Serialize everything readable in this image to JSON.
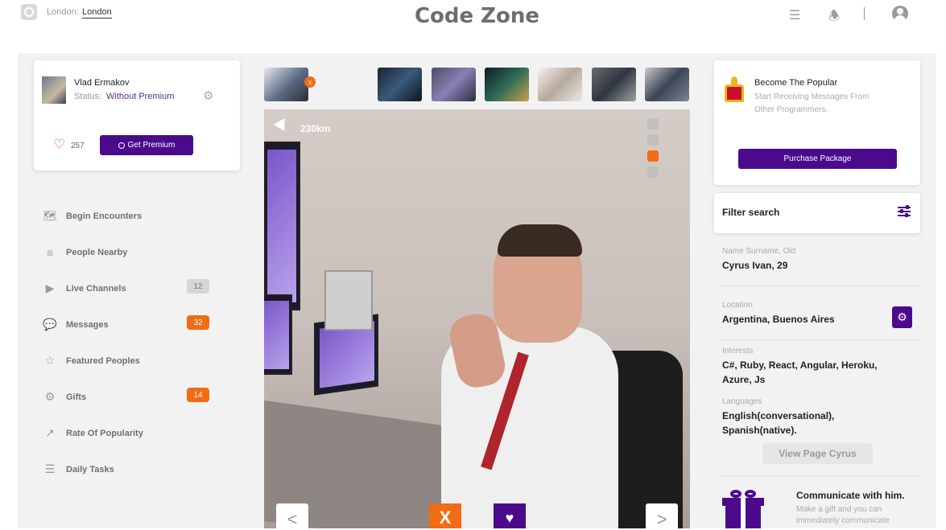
{
  "topbar": {
    "location_label": "London:",
    "location_value": "London",
    "brand": "Code Zone",
    "icons": [
      "list-icon",
      "bell-icon",
      "user-icon"
    ]
  },
  "profile": {
    "name": "Vlad Ermakov",
    "status_label": "Status:",
    "status_value": "Without Premium",
    "likes": "257",
    "premium_button": "Get Premium"
  },
  "menu": {
    "items": [
      {
        "label": "Begin Encounters",
        "icon": "map-icon"
      },
      {
        "label": "People Nearby",
        "icon": "stack-icon"
      },
      {
        "label": "Live Channels",
        "icon": "video-icon",
        "badge": "12"
      },
      {
        "label": "Messages",
        "icon": "chat-icon",
        "badge": "32"
      },
      {
        "label": "Featured Peoples",
        "icon": "star-icon"
      },
      {
        "label": "Gifts",
        "icon": "gear-icon",
        "badge": "14"
      },
      {
        "label": "Rate Of Popularity",
        "icon": "chart-icon"
      },
      {
        "label": "Daily Tasks",
        "icon": "list-icon"
      }
    ]
  },
  "photo": {
    "distance": "230km",
    "x_label": "X",
    "prev": "<",
    "next": ">",
    "remove_thumb": "x"
  },
  "promo": {
    "title": "Become The Popular",
    "subtitle": "Start Receiving Messages From Other Programmers.",
    "button": "Purchase Package"
  },
  "filter": {
    "title": "Filter search"
  },
  "candidate": {
    "name_label": "Name Surname, Old",
    "name_value": "Cyrus Ivan, 29",
    "location_label": "Location",
    "location_value": "Argentina, Buenos Aires",
    "interests_label": "Interests",
    "interests_value": "C#, Ruby, React, Angular, Heroku, Azure, Js",
    "languages_label": "Languages",
    "languages_value": "English(conversational), Spanish(native).",
    "view_button": "View Page Cyrus"
  },
  "communicate": {
    "title": "Communicate with him.",
    "subtitle": "Make a gift and you can immediately communicate"
  },
  "colors": {
    "purple": "#4b0a8c",
    "orange": "#f26b15",
    "status_purple": "#5c2d91"
  }
}
